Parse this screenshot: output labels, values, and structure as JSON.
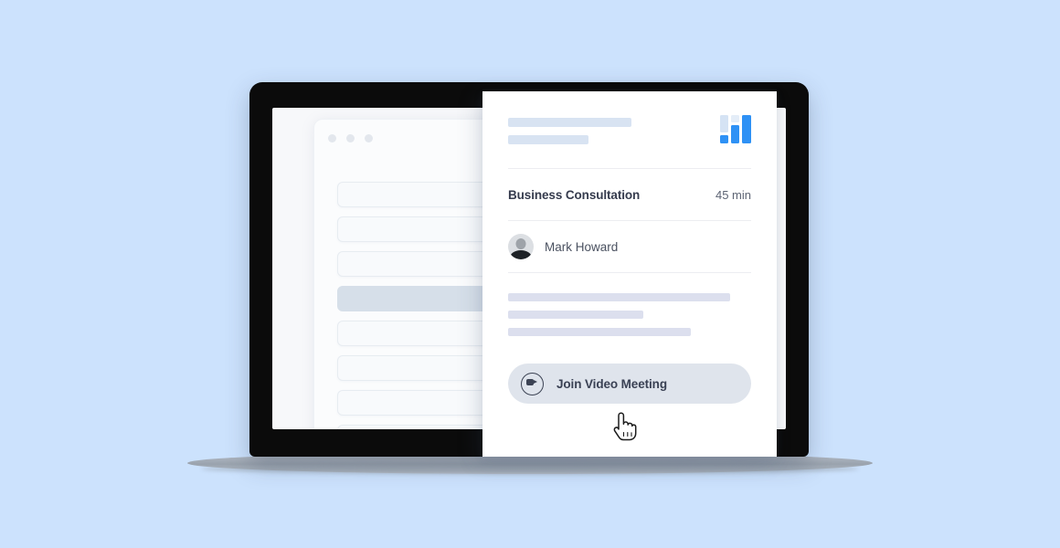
{
  "background": {
    "page_color": "#cce2fd"
  },
  "device": {
    "name": "laptop-mockup",
    "bezel_color": "#0b0b0b",
    "screen_color": "#f7f8fa"
  },
  "bg_window": {
    "name": "scheduling-window",
    "traffic_lights": [
      "dot-1",
      "dot-2",
      "dot-3"
    ],
    "slots": [
      {
        "label": "",
        "selected": false
      },
      {
        "label": "",
        "selected": false
      },
      {
        "label": "",
        "selected": false
      },
      {
        "label": "",
        "selected": true
      },
      {
        "label": "",
        "selected": false
      },
      {
        "label": "",
        "selected": false
      },
      {
        "label": "",
        "selected": false
      },
      {
        "label": "",
        "selected": false
      }
    ]
  },
  "card": {
    "header": {
      "skeleton_lines": [
        "",
        ""
      ],
      "logo": {
        "icon": "grid-blocks-logo-icon",
        "accent": "#2e91f5",
        "muted": "#d5e3f4"
      }
    },
    "service": {
      "title": "Business Consultation",
      "duration": "45 min"
    },
    "host": {
      "avatar": "user-photo-avatar",
      "name": "Mark Howard"
    },
    "body_skeleton_lines": [
      "",
      "",
      ""
    ],
    "join_button": {
      "icon": "video-camera-icon",
      "label": "Join Video Meeting",
      "background": "#dfe4ec"
    }
  },
  "cursor": {
    "icon": "pointing-hand-cursor"
  }
}
